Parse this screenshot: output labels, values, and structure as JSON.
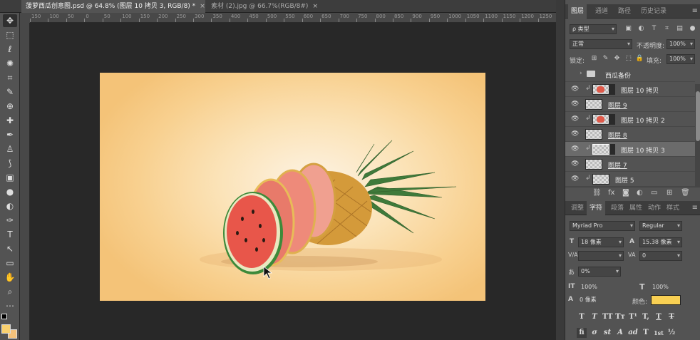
{
  "tabs": [
    {
      "label": "菠萝西瓜创意图.psd @ 64.8% (图层 10 拷贝 3, RGB/8) *",
      "close": "×"
    },
    {
      "label": "素材 (2).jpg @ 66.7%(RGB/8#)",
      "close": "×"
    }
  ],
  "ruler": {
    "ticks": [
      "150",
      "100",
      "50",
      "0",
      "50",
      "100",
      "150",
      "200",
      "250",
      "300",
      "350",
      "400",
      "450",
      "500",
      "550",
      "600",
      "650",
      "700",
      "750",
      "800",
      "850",
      "900",
      "950",
      "1000",
      "1050",
      "1100",
      "1150",
      "1200",
      "1250"
    ]
  },
  "tools": [
    "✥",
    "⬚",
    "ℓ",
    "✺",
    "⌗",
    "✎",
    "⊕",
    "✚",
    "✒",
    "♙",
    "⟆",
    "◌",
    "▣",
    "●",
    "◐",
    "✑",
    "T",
    "↖",
    "▭",
    "✋",
    "⌕",
    "⋯"
  ],
  "layers_panel": {
    "tabs": [
      "图层",
      "通道",
      "路径",
      "历史记录"
    ],
    "menu": "≡",
    "filter_kind": "ρ 类型",
    "filter_icons": [
      "▣",
      "◐",
      "T",
      "⌗",
      "▤",
      "●"
    ],
    "blend_mode": "正常",
    "opacity_label": "不透明度:",
    "opacity_value": "100%",
    "lock_label": "锁定:",
    "lock_icons": [
      "⊞",
      "✎",
      "✥",
      "⬚",
      "🔒"
    ],
    "fill_label": "填充:",
    "fill_value": "100%",
    "layers": [
      {
        "name": "西瓜备份",
        "type": "group",
        "visible": false
      },
      {
        "name": "图层 10 拷贝",
        "type": "clip-fruit",
        "visible": true
      },
      {
        "name": "图层 9",
        "type": "plain",
        "visible": true
      },
      {
        "name": "图层 10 拷贝 2",
        "type": "clip-fruit",
        "visible": true
      },
      {
        "name": "图层 8",
        "type": "plain",
        "visible": true
      },
      {
        "name": "图层 10 拷贝 3",
        "type": "clip-selected",
        "visible": true
      },
      {
        "name": "图层 7",
        "type": "plain",
        "visible": true
      },
      {
        "name": "图层 5",
        "type": "clip-plain",
        "visible": true
      }
    ],
    "footer_icons": [
      "⛓",
      "fx",
      "◙",
      "◐",
      "▭",
      "⊞",
      "🗑"
    ]
  },
  "character_panel": {
    "tabs": [
      "调整",
      "字符",
      "段落",
      "属性",
      "动作",
      "样式"
    ],
    "font_family": "Myriad Pro",
    "font_style": "Regular",
    "size_icon": "T",
    "size_value": "18 像素",
    "leading_icon": "A",
    "leading_value": "15.38 像素",
    "kerning_icon": "V/A",
    "kerning_value": "",
    "tracking_icon": "VA",
    "tracking_value": "0",
    "scale_icon": "あ",
    "scale_value": "0%",
    "vscale_icon": "IT",
    "vscale_value": "100%",
    "hscale_icon": "T",
    "hscale_value": "100%",
    "baseline_icon": "A",
    "baseline_value": "0 像素",
    "color_label": "颜色:",
    "color_value": "#f9d053",
    "format_row1": [
      "T",
      "T",
      "TT",
      "Tт",
      "T¹",
      "T,",
      "T",
      "T"
    ],
    "format_row2": [
      "fi",
      "σ",
      "st",
      "A",
      "ad",
      "T",
      "1st",
      "½"
    ]
  },
  "colors": {
    "fg_swatch": "#f9d170",
    "bg_swatch": "#f3c17a",
    "accent": "#535353"
  }
}
